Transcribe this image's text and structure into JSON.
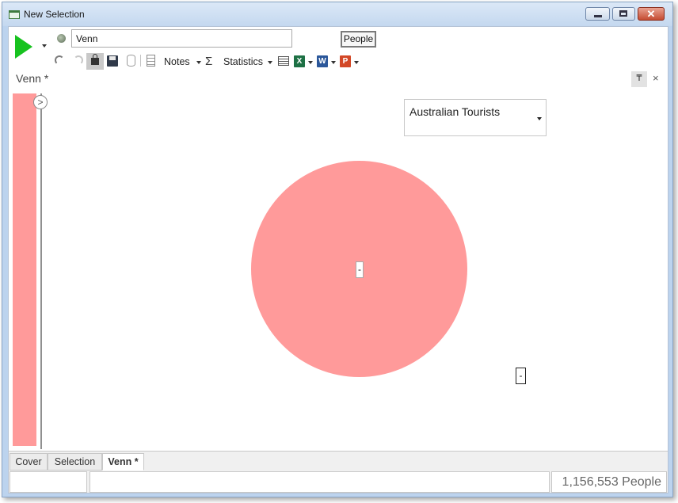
{
  "window": {
    "title": "New Selection",
    "minimize_label": "",
    "maximize_label": "",
    "close_label": "✕"
  },
  "toolbar": {
    "name_value": "Venn",
    "people_label": "People",
    "notes_label": "Notes",
    "statistics_label": "Statistics",
    "sigma": "Σ",
    "excel_label": "X",
    "word_label": "W",
    "ppt_label": "P"
  },
  "document": {
    "tab_title": "Venn *",
    "pin_glyph": "₸",
    "close_glyph": "×",
    "expand_glyph": ">"
  },
  "venn": {
    "dropdown_value": "Australian Tourists",
    "circle_label": "-",
    "outside_label": "-",
    "circle_color": "#ff9a9a"
  },
  "bottom_tabs": [
    {
      "label": "Cover"
    },
    {
      "label": "Selection"
    },
    {
      "label": "Venn *"
    }
  ],
  "status": {
    "count": "1,156,553 People"
  }
}
